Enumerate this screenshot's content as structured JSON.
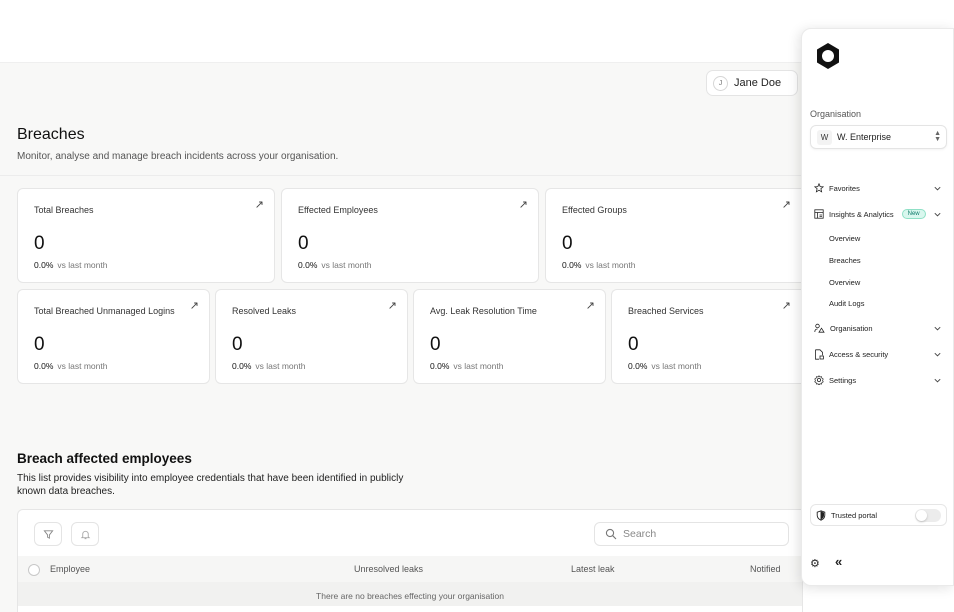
{
  "header": {
    "user": {
      "initial": "J",
      "name": "Jane Doe"
    }
  },
  "page": {
    "title": "Breaches",
    "subtitle": "Monitor, analyse and manage breach incidents across your organisation."
  },
  "stats_top": [
    {
      "label": "Total Breaches",
      "value": "0",
      "delta": "0.0%",
      "delta_note": "vs last month"
    },
    {
      "label": "Effected Employees",
      "value": "0",
      "delta": "0.0%",
      "delta_note": "vs last month"
    },
    {
      "label": "Effected Groups",
      "value": "0",
      "delta": "0.0%",
      "delta_note": "vs last month"
    }
  ],
  "stats_bottom": [
    {
      "label": "Total Breached Unmanaged Logins",
      "value": "0",
      "delta": "0.0%",
      "delta_note": "vs last month"
    },
    {
      "label": "Resolved Leaks",
      "value": "0",
      "delta": "0.0%",
      "delta_note": "vs last month"
    },
    {
      "label": "Avg. Leak Resolution Time",
      "value": "0",
      "delta": "0.0%",
      "delta_note": "vs last month"
    },
    {
      "label": "Breached Services",
      "value": "0",
      "delta": "0.0%",
      "delta_note": "vs last month"
    }
  ],
  "employees_section": {
    "title": "Breach affected employees",
    "description": "This list provides visibility into employee credentials that have been identified in publicly known data breaches.",
    "search_placeholder": "Search",
    "columns": [
      "Employee",
      "Unresolved leaks",
      "Latest leak",
      "Notified"
    ],
    "empty_message": "There are no breaches effecting your organisation"
  },
  "sidebar": {
    "org_label": "Organisation",
    "org_initial": "W",
    "org_name": "W. Enterprise",
    "nav": {
      "favorites": "Favorites",
      "insights": "Insights & Analytics",
      "insights_badge": "New",
      "insights_children": [
        "Overview",
        "Breaches",
        "Overview",
        "Audit Logs"
      ],
      "organisation": "Organisation",
      "access": "Access & security",
      "settings": "Settings"
    },
    "trusted_portal": "Trusted portal",
    "trusted_portal_on": false
  },
  "icons": {
    "card_arrow": "arrow-up-right-icon",
    "filter": "filter-icon",
    "bell": "bell-icon",
    "search": "search-icon",
    "favorites": "star-icon",
    "insights": "chart-grid-icon",
    "organisation": "users-icon",
    "access": "file-lock-icon",
    "settings": "gear-icon",
    "trusted": "shield-icon",
    "collapse": "double-chevron-left-icon"
  }
}
